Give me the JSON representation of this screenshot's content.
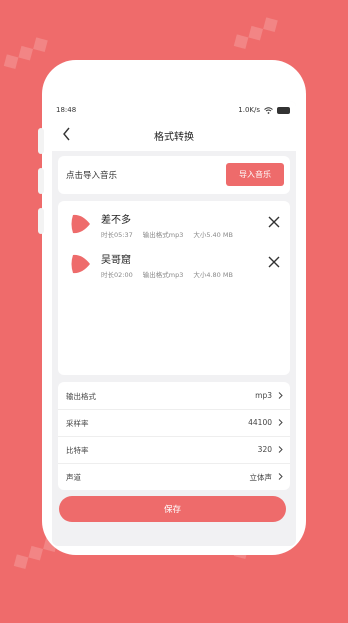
{
  "colors": {
    "background": "#ef6b6b",
    "accent": "#ee6b6b",
    "screen_bg": "#f1f1f3"
  },
  "status_bar": {
    "time": "18:48",
    "speed": "1.0K/s",
    "battery_icon": "battery-icon",
    "wifi_icon": "wifi-icon"
  },
  "header": {
    "title": "格式转换",
    "back_icon": "back-arrow-icon"
  },
  "import_section": {
    "label": "点击导入音乐",
    "button_label": "导入音乐"
  },
  "songs": [
    {
      "title": "差不多",
      "duration": "时长05:37",
      "format": "输出格式mp3",
      "size": "大小5.40 MB"
    },
    {
      "title": "吴哥窟",
      "duration": "时长02:00",
      "format": "输出格式mp3",
      "size": "大小4.80 MB"
    }
  ],
  "settings": [
    {
      "label": "输出格式",
      "value": "mp3"
    },
    {
      "label": "采样率",
      "value": "44100"
    },
    {
      "label": "比特率",
      "value": "320"
    },
    {
      "label": "声道",
      "value": "立体声"
    }
  ],
  "save_button": {
    "label": "保存"
  }
}
